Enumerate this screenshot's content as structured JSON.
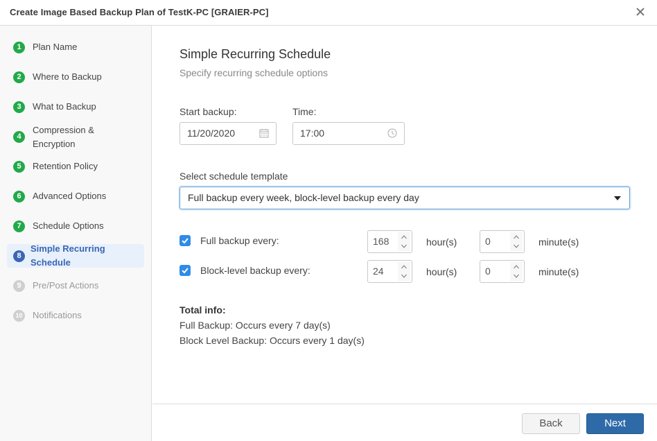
{
  "window": {
    "title": "Create Image Based Backup Plan of TestK-PC [GRAIER-PC]",
    "close_icon": "close-icon"
  },
  "sidebar": {
    "steps": [
      {
        "number": "1",
        "label": "Plan Name",
        "state": "done"
      },
      {
        "number": "2",
        "label": "Where to Backup",
        "state": "done"
      },
      {
        "number": "3",
        "label": "What to Backup",
        "state": "done"
      },
      {
        "number": "4",
        "label_line1": "Compression &",
        "label_line2": "Encryption",
        "state": "done"
      },
      {
        "number": "5",
        "label": "Retention Policy",
        "state": "done"
      },
      {
        "number": "6",
        "label": "Advanced Options",
        "state": "done"
      },
      {
        "number": "7",
        "label": "Schedule Options",
        "state": "done"
      },
      {
        "number": "8",
        "label_line1": "Simple Recurring",
        "label_line2": "Schedule",
        "state": "current"
      },
      {
        "number": "9",
        "label": "Pre/Post Actions",
        "state": "pending"
      },
      {
        "number": "10",
        "label": "Notifications",
        "state": "pending"
      }
    ]
  },
  "main": {
    "title": "Simple Recurring Schedule",
    "subtitle": "Specify recurring schedule options",
    "start_backup": {
      "label": "Start backup:",
      "value": "11/20/2020",
      "icon": "calendar-icon"
    },
    "time": {
      "label": "Time:",
      "value": "17:00",
      "icon": "clock-icon"
    },
    "template": {
      "label": "Select schedule template",
      "selected": "Full backup every week, block-level backup every day"
    },
    "rows": [
      {
        "label": "Full backup every:",
        "checked": true,
        "hours": "168",
        "hours_unit": "hour(s)",
        "minutes": "0",
        "minutes_unit": "minute(s)"
      },
      {
        "label": "Block-level backup every:",
        "checked": true,
        "hours": "24",
        "hours_unit": "hour(s)",
        "minutes": "0",
        "minutes_unit": "minute(s)"
      }
    ],
    "total_info": {
      "title": "Total info:",
      "lines": [
        "Full Backup: Occurs every 7 day(s)",
        "Block Level Backup: Occurs every 1 day(s)"
      ]
    }
  },
  "footer": {
    "back_label": "Back",
    "next_label": "Next"
  },
  "colors": {
    "step_done": "#22a94a",
    "step_current": "#3a66b4",
    "step_pending": "#cfcfcf",
    "accent_button": "#2f6aa8",
    "checkbox": "#2f8ce8"
  }
}
